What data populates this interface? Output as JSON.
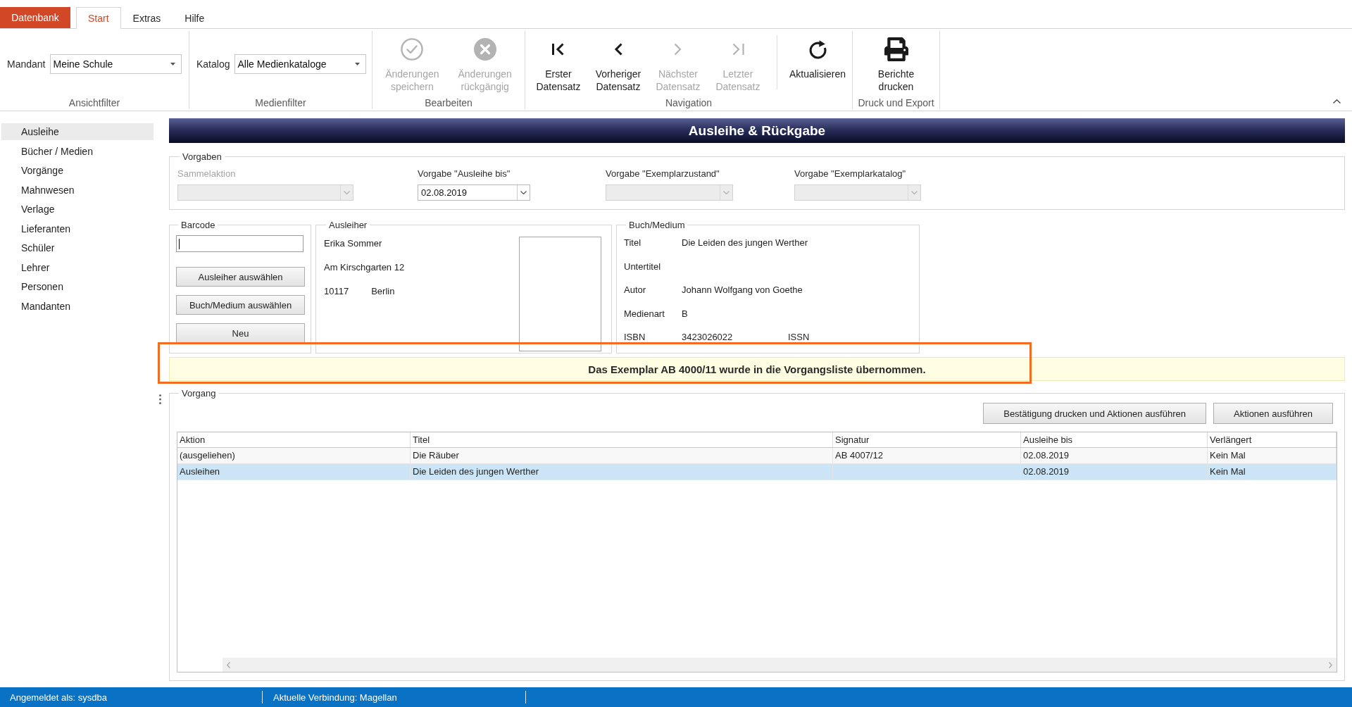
{
  "ribbon": {
    "app_button": "Datenbank",
    "tabs": [
      {
        "label": "Start",
        "selected": true
      },
      {
        "label": "Extras",
        "selected": false
      },
      {
        "label": "Hilfe",
        "selected": false
      }
    ],
    "groups": [
      {
        "kind": "filter",
        "label": "Ansichtfilter",
        "field_label": "Mandant",
        "value": "Meine Schule"
      },
      {
        "kind": "filter",
        "label": "Medienfilter",
        "field_label": "Katalog",
        "value": "Alle Medienkataloge"
      },
      {
        "kind": "buttons",
        "label": "Bearbeiten",
        "sections": [
          [
            {
              "kind": "save",
              "lines": [
                "Änderungen",
                "speichern"
              ],
              "disabled": true
            },
            {
              "kind": "undo",
              "lines": [
                "Änderungen",
                "rückgängig"
              ],
              "disabled": true
            }
          ]
        ]
      },
      {
        "kind": "buttons",
        "label": "Navigation",
        "sections": [
          [
            {
              "kind": "first",
              "lines": [
                "Erster",
                "Datensatz"
              ],
              "disabled": false
            },
            {
              "kind": "previous",
              "lines": [
                "Vorheriger",
                "Datensatz"
              ],
              "disabled": false
            },
            {
              "kind": "next",
              "lines": [
                "Nächster",
                "Datensatz"
              ],
              "disabled": true
            },
            {
              "kind": "last",
              "lines": [
                "Letzter",
                "Datensatz"
              ],
              "disabled": true
            }
          ],
          [
            {
              "kind": "refresh",
              "lines": [
                "Aktualisieren"
              ],
              "disabled": false
            }
          ]
        ]
      },
      {
        "kind": "buttons",
        "label": "Druck und Export",
        "sections": [
          [
            {
              "kind": "print",
              "lines": [
                "Berichte",
                "drucken"
              ],
              "disabled": false
            }
          ]
        ]
      }
    ]
  },
  "sidebar": {
    "items": [
      {
        "label": "Ausleihe",
        "selected": true
      },
      {
        "label": "Bücher / Medien",
        "selected": false
      },
      {
        "label": "Vorgänge",
        "selected": false
      },
      {
        "label": "Mahnwesen",
        "selected": false
      },
      {
        "label": "Verlage",
        "selected": false
      },
      {
        "label": "Lieferanten",
        "selected": false
      },
      {
        "label": "Schüler",
        "selected": false
      },
      {
        "label": "Lehrer",
        "selected": false
      },
      {
        "label": "Personen",
        "selected": false
      },
      {
        "label": "Mandanten",
        "selected": false
      }
    ]
  },
  "page_title": "Ausleihe & Rückgabe",
  "defaults": {
    "title": "Vorgaben",
    "fields": [
      {
        "label": "Sammelaktion",
        "label_greyed": true,
        "disabled": true
      },
      {
        "label": "Vorgabe \"Ausleihe bis\"",
        "label_greyed": false,
        "disabled": false,
        "value": "02.08.2019"
      },
      {
        "label": "Vorgabe \"Exemplarzustand\"",
        "label_greyed": false,
        "disabled": true
      },
      {
        "label": "Vorgabe \"Exemplarkatalog\"",
        "label_greyed": false,
        "disabled": true
      }
    ]
  },
  "barcode": {
    "title": "Barcode",
    "focused": true,
    "buttons": [
      "Ausleiher auswählen",
      "Buch/Medium auswählen",
      "Neu"
    ]
  },
  "borrower": {
    "title": "Ausleiher",
    "name": "Erika Sommer",
    "street": "Am Kirschgarten 12",
    "postal_code": "10117",
    "city": "Berlin"
  },
  "medium": {
    "title": "Buch/Medium",
    "rows": [
      {
        "label": "Titel",
        "value": "Die Leiden des jungen Werther"
      },
      {
        "label": "Untertitel"
      },
      {
        "label": "Autor",
        "value": "Johann Wolfgang von Goethe"
      },
      {
        "label": "Medienart",
        "value": "B"
      },
      {
        "label": "ISBN",
        "value": "3423026022",
        "extra_label": "ISSN"
      }
    ]
  },
  "message": "Das Exemplar AB 4000/11 wurde in die Vorgangsliste übernommen.",
  "transactions": {
    "title": "Vorgang",
    "buttons": [
      "Bestätigung drucken und Aktionen ausführen",
      "Aktionen ausführen"
    ],
    "table": {
      "columns": [
        "Aktion",
        "Titel",
        "Signatur",
        "Ausleihe bis",
        "Verlängert"
      ],
      "rows": [
        {
          "cells": [
            "(ausgeliehen)",
            "Die Räuber",
            "AB 4007/12",
            "02.08.2019",
            "Kein Mal"
          ],
          "selected": false
        },
        {
          "cells": [
            "Ausleihen",
            "Die Leiden des jungen Werther",
            null,
            "02.08.2019",
            "Kein Mal"
          ],
          "selected": true
        }
      ]
    }
  },
  "status_bar": [
    "Angemeldet als: sysdba",
    "Aktuelle Verbindung: Magellan"
  ]
}
